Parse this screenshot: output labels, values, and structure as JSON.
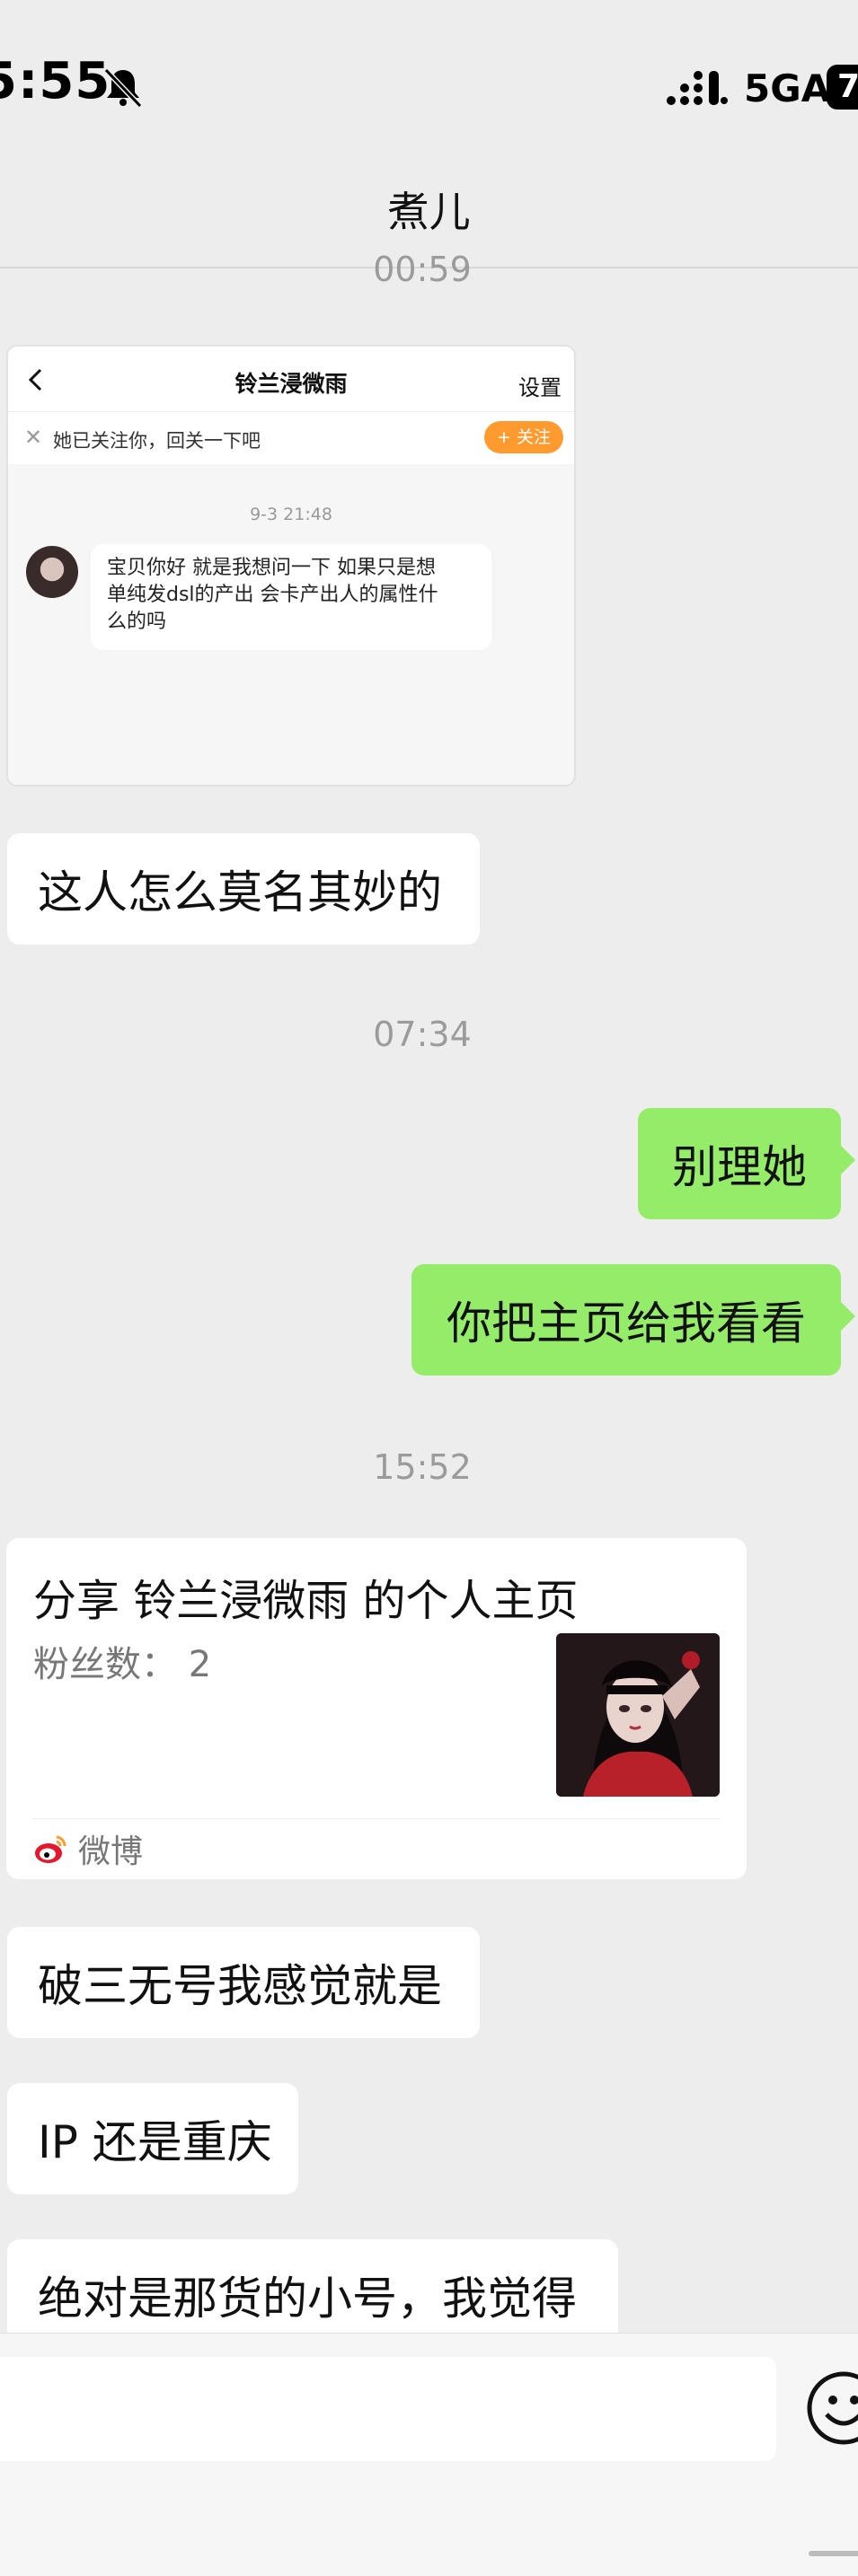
{
  "status_bar": {
    "time": "5:55",
    "network": "5GA",
    "battery": "7"
  },
  "nav": {
    "title": "煮儿"
  },
  "messages": {
    "ts_top": "00:59",
    "screenshot": {
      "title": "铃兰浸微雨",
      "settings": "设置",
      "follow_text": "她已关注你，回关一下吧",
      "follow_button": "+ 关注",
      "timestamp": "9-3 21:48",
      "message_line1": "宝贝你好 就是我想问一下 如果只是想",
      "message_line2": "单纯发dsl的产出 会卡产出人的属性什",
      "message_line3": "么的吗"
    },
    "left_1": "这人怎么莫名其妙的",
    "ts_2": "07:34",
    "right_1": "别理她",
    "right_2": "你把主页给我看看",
    "ts_3": "15:52",
    "card": {
      "title": "分享 铃兰浸微雨 的个人主页",
      "fans": "粉丝数：  2",
      "brand": "微博"
    },
    "left_2": "破三无号我感觉就是",
    "left_3": "IP 还是重庆",
    "left_4": "绝对是那货的小号，我觉得"
  },
  "colors": {
    "sent_bubble": "#95ec69",
    "follow_button": "#ff9a2e",
    "background": "#ededed"
  },
  "icons": [
    "bell-muted-icon",
    "signal-icon",
    "back-icon",
    "close-icon",
    "weibo-icon",
    "emoji-icon"
  ]
}
